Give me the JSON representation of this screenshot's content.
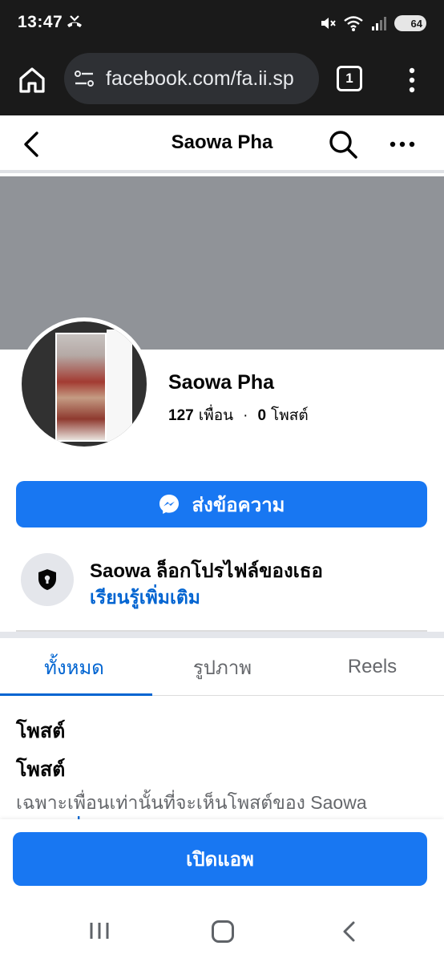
{
  "status_bar": {
    "time": "13:47",
    "battery": "64"
  },
  "browser": {
    "url": "facebook.com/fa.ii.sp",
    "tab_count": "1"
  },
  "fb_header": {
    "title": "Saowa Pha"
  },
  "profile": {
    "name": "Saowa Pha",
    "friends_count": "127",
    "friends_label": "เพื่อน",
    "separator": "·",
    "posts_count": "0",
    "posts_label": "โพสต์"
  },
  "message_button": {
    "label": "ส่งข้อความ"
  },
  "locked_notice": {
    "title": "Saowa ล็อกโปรไฟล์ของเธอ",
    "link": "เรียนรู้เพิ่มเติม"
  },
  "tabs": [
    {
      "label": "ทั้งหมด",
      "active": true
    },
    {
      "label": "รูปภาพ",
      "active": false
    },
    {
      "label": "Reels",
      "active": false
    }
  ],
  "posts_section": {
    "heading": "โพสต์",
    "post_label": "โพสต์",
    "privacy_text": "เฉพาะเพื่อนเท่านั้นที่จะเห็นโพสต์ของ Saowa",
    "cutoff_text": "เรียนรู้เพิ่มเติม"
  },
  "open_app": {
    "label": "เปิดแอพ"
  },
  "colors": {
    "fb_blue": "#1877f2",
    "link_blue": "#0064d1",
    "cover_gray": "#909398"
  }
}
